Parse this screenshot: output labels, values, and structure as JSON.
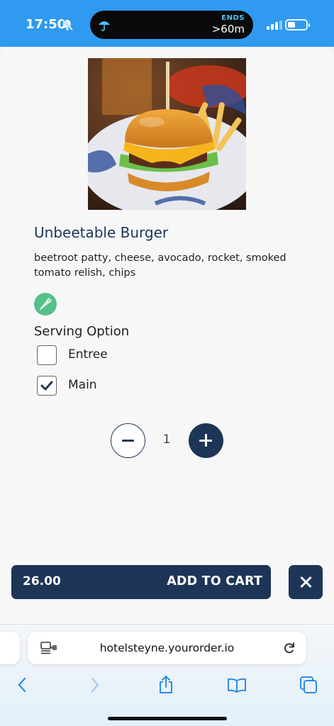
{
  "status_bar": {
    "time": "17:50",
    "live_activity": {
      "label": "ENDS",
      "value": ">60m"
    }
  },
  "item": {
    "title": "Unbeetable Burger",
    "description": "beetroot patty, cheese, avocado, rocket, smoked tomato relish, chips",
    "dietary_icon": "carrot-icon"
  },
  "serving": {
    "title": "Serving Option",
    "options": [
      {
        "label": "Entree",
        "checked": false
      },
      {
        "label": "Main",
        "checked": true
      }
    ]
  },
  "quantity": {
    "value": "1"
  },
  "cart": {
    "price": "26.00",
    "label": "ADD TO CART"
  },
  "browser": {
    "url": "hotelsteyne.yourorder.io"
  },
  "colors": {
    "status_bar": "#2f9af0",
    "primary": "#1d3557",
    "veg_badge": "#56c08b"
  }
}
